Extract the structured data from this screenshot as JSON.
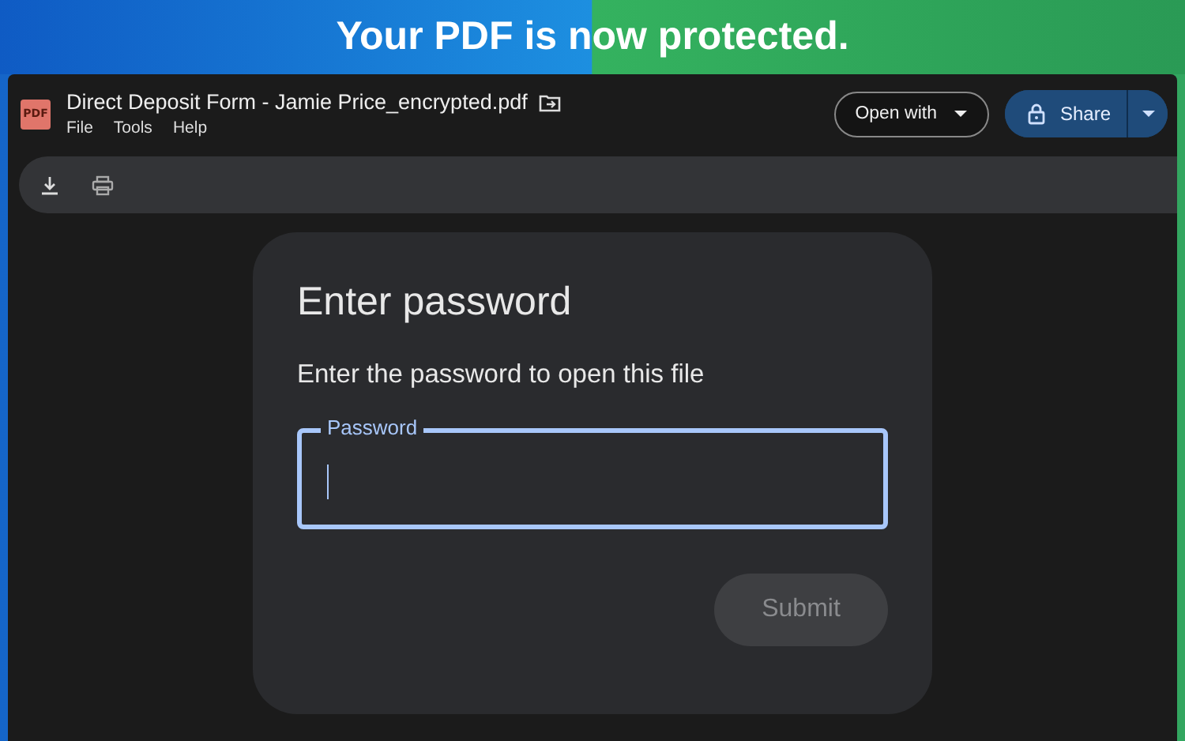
{
  "banner": {
    "headline": "Your PDF is now protected."
  },
  "window": {
    "title": "Direct Deposit Form - Jamie Price_encrypted.pdf",
    "file_badge": "PDF",
    "menu": [
      "File",
      "Tools",
      "Help"
    ]
  },
  "header_buttons": {
    "open_with": "Open with",
    "share": "Share"
  },
  "dialog": {
    "title": "Enter password",
    "message": "Enter the password to open this file",
    "field": {
      "label": "Password",
      "focused": true
    },
    "submit": {
      "label": "Submit",
      "disabled": true
    }
  }
}
